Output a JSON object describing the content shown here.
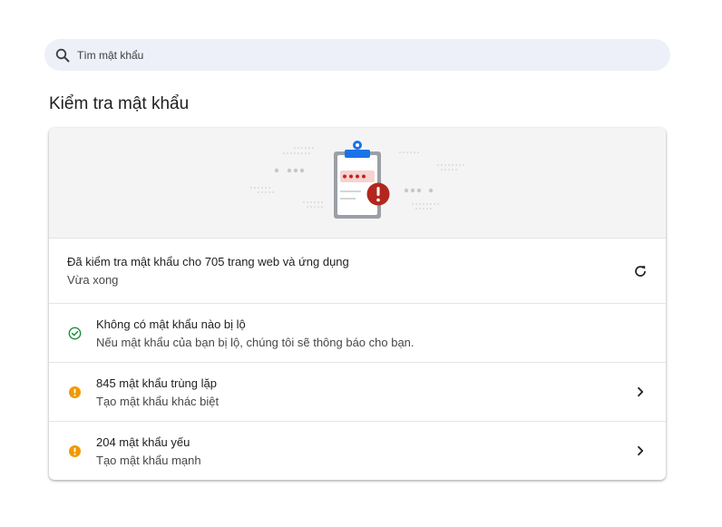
{
  "search": {
    "placeholder": "Tìm mật khẩu",
    "icon": "search-icon"
  },
  "section_title": "Kiểm tra mật khẩu",
  "summary": {
    "title": "Đã kiểm tra mật khẩu cho 705 trang web và ứng dụng",
    "subtitle": "Vừa xong",
    "action_icon": "refresh-icon"
  },
  "items": [
    {
      "title": "Không có mật khẩu nào bị lộ",
      "subtitle": "Nếu mật khẩu của bạn bị lộ, chúng tôi sẽ thông báo cho bạn.",
      "status_icon": "check-circle-icon",
      "status_color": "#1e8e3e"
    },
    {
      "title": "845 mật khẩu trùng lặp",
      "subtitle": "Tạo mật khẩu khác biệt",
      "status_icon": "warning-icon",
      "status_color": "#f29900",
      "action_icon": "chevron-right-icon"
    },
    {
      "title": "204 mật khẩu yếu",
      "subtitle": "Tạo mật khẩu mạnh",
      "status_icon": "warning-icon",
      "status_color": "#f29900",
      "action_icon": "chevron-right-icon"
    }
  ],
  "colors": {
    "search_bg": "#edf0f8",
    "banner_bg": "#f4f4f5",
    "alert_red": "#b3261e",
    "clipboard_blue": "#1a73e8"
  }
}
